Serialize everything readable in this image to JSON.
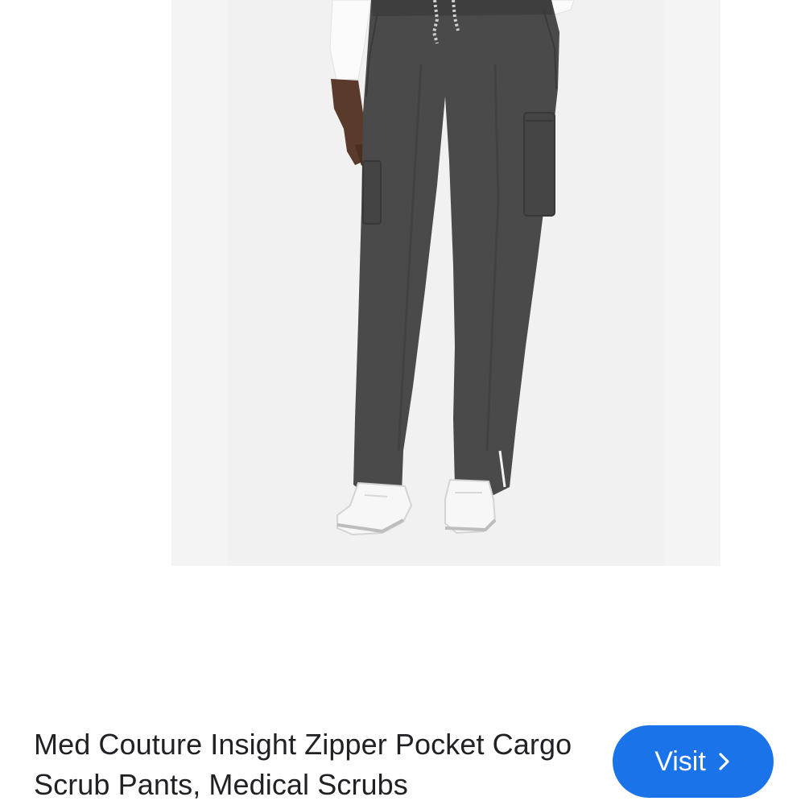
{
  "product": {
    "title": "Med Couture Insight Zipper Pocket Cargo Scrub Pants, Medical Scrubs",
    "image_alt": "Charcoal cargo scrub pants worn with white sneakers",
    "image_background": "#f4f4f4",
    "pants_color": "#4a4a4a"
  },
  "actions": {
    "visit_label": "Visit",
    "visit_icon": "chevron-right-icon",
    "accent_color": "#1a73e8"
  }
}
